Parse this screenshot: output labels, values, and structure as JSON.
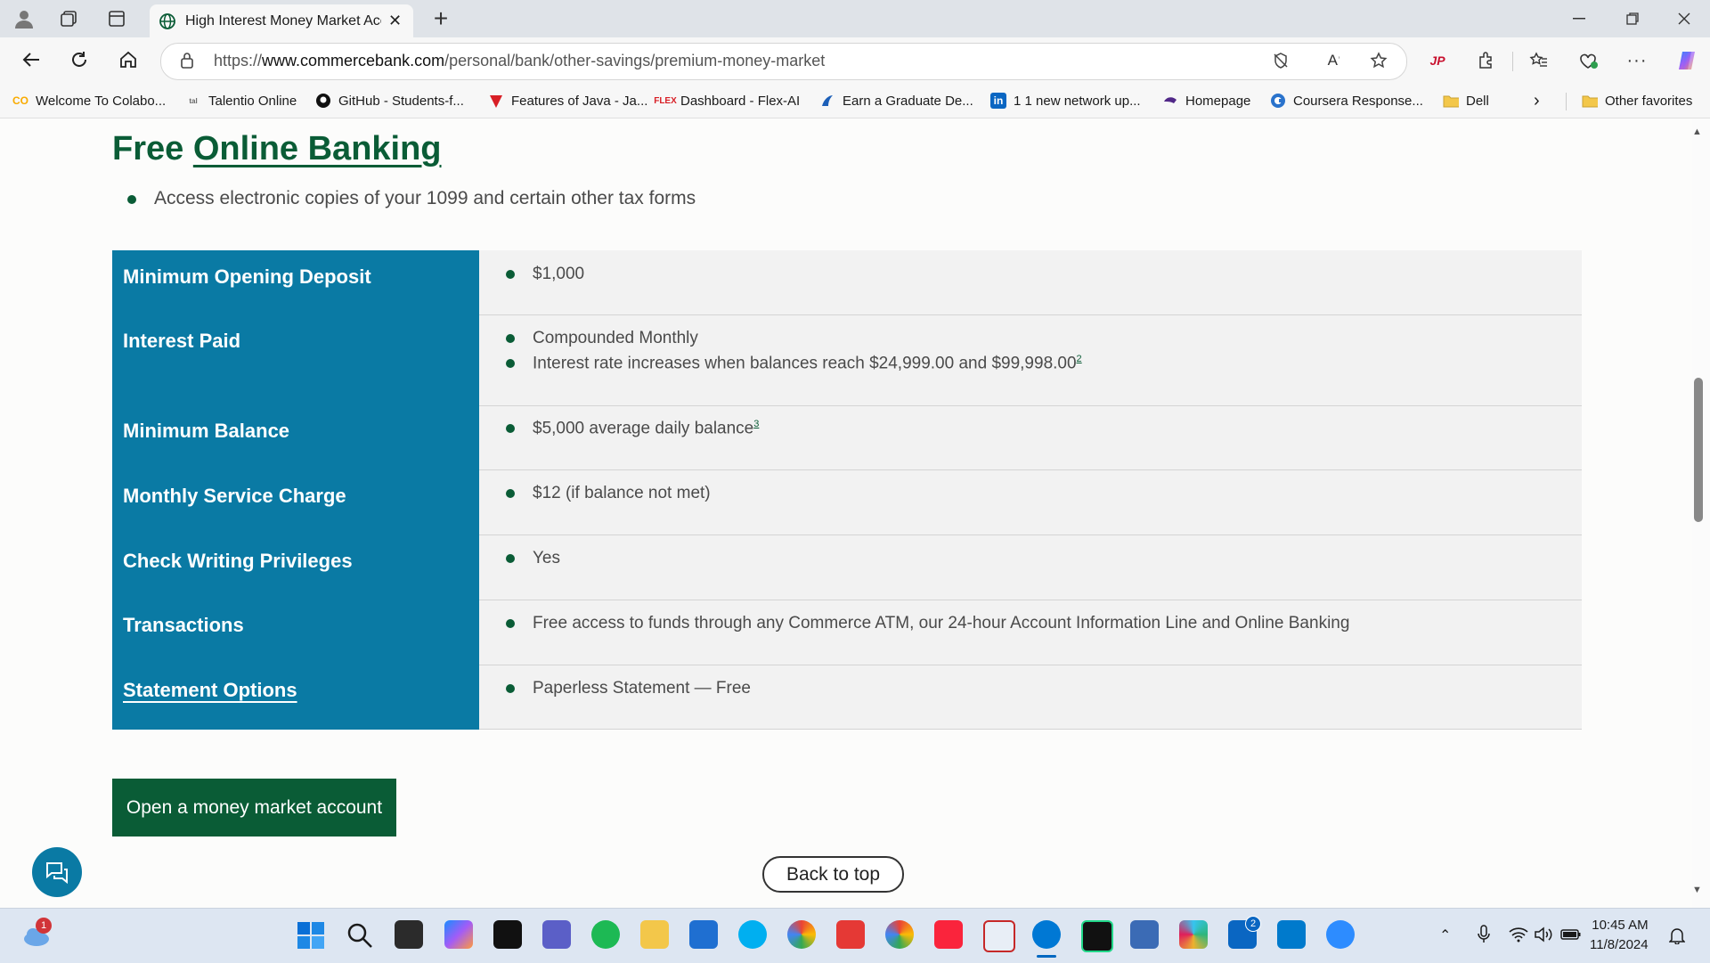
{
  "browser": {
    "tab_title": "High Interest Money Market Acco",
    "url_prefix": "https://",
    "url_domain": "www.commercebank.com",
    "url_path": "/personal/bank/other-savings/premium-money-market",
    "new_tab": "+",
    "close_tab": "✕"
  },
  "bookmarks": [
    {
      "label": "Welcome To Colabo...",
      "icon": "colab-icon"
    },
    {
      "label": "Talentio Online",
      "icon": "talentio-icon"
    },
    {
      "label": "GitHub - Students-f...",
      "icon": "github-icon"
    },
    {
      "label": "Features of Java - Ja...",
      "icon": "javatpoint-icon"
    },
    {
      "label": "Dashboard - Flex-AI",
      "icon": "flex-icon"
    },
    {
      "label": "Earn a Graduate De...",
      "icon": "university-icon"
    },
    {
      "label": "1 1 new network up...",
      "icon": "linkedin-icon"
    },
    {
      "label": "Homepage",
      "icon": "homepage-icon"
    },
    {
      "label": "Coursera Response...",
      "icon": "coursera-icon"
    },
    {
      "label": "Dell",
      "icon": "folder-icon"
    },
    {
      "label": "Other favorites",
      "icon": "folder-icon"
    }
  ],
  "page": {
    "heading_prefix": "Free ",
    "heading_link": "Online Banking",
    "intro_bullet": "Access electronic copies of your 1099 and certain other tax forms",
    "rows": [
      {
        "label": "Minimum Opening Deposit",
        "values": [
          "$1,000"
        ]
      },
      {
        "label": "Interest Paid",
        "values": [
          "Compounded Monthly",
          "Interest rate increases when balances reach $24,999.00 and $99,998.00"
        ],
        "footnote": "2"
      },
      {
        "label": "Minimum Balance",
        "values": [
          "$5,000 average daily balance"
        ],
        "footnote": "3"
      },
      {
        "label": "Monthly Service Charge",
        "values": [
          "$12 (if balance not met)"
        ]
      },
      {
        "label": "Check Writing Privileges",
        "values": [
          "Yes"
        ]
      },
      {
        "label": "Transactions",
        "values": [
          "Free access to funds through any Commerce ATM, our 24-hour Account Information Line and Online Banking"
        ]
      },
      {
        "label": "Statement Options",
        "values": [
          "Paperless Statement — Free"
        ]
      }
    ],
    "cta_label": "Open a money market account",
    "back_to_top": "Back to top"
  },
  "taskbar": {
    "notification_badge": "1",
    "linkedin_badge": "2",
    "time": "10:45 AM",
    "date": "11/8/2024"
  },
  "colors": {
    "brand_green": "#0a5c36",
    "table_blue": "#0a7aa4"
  }
}
